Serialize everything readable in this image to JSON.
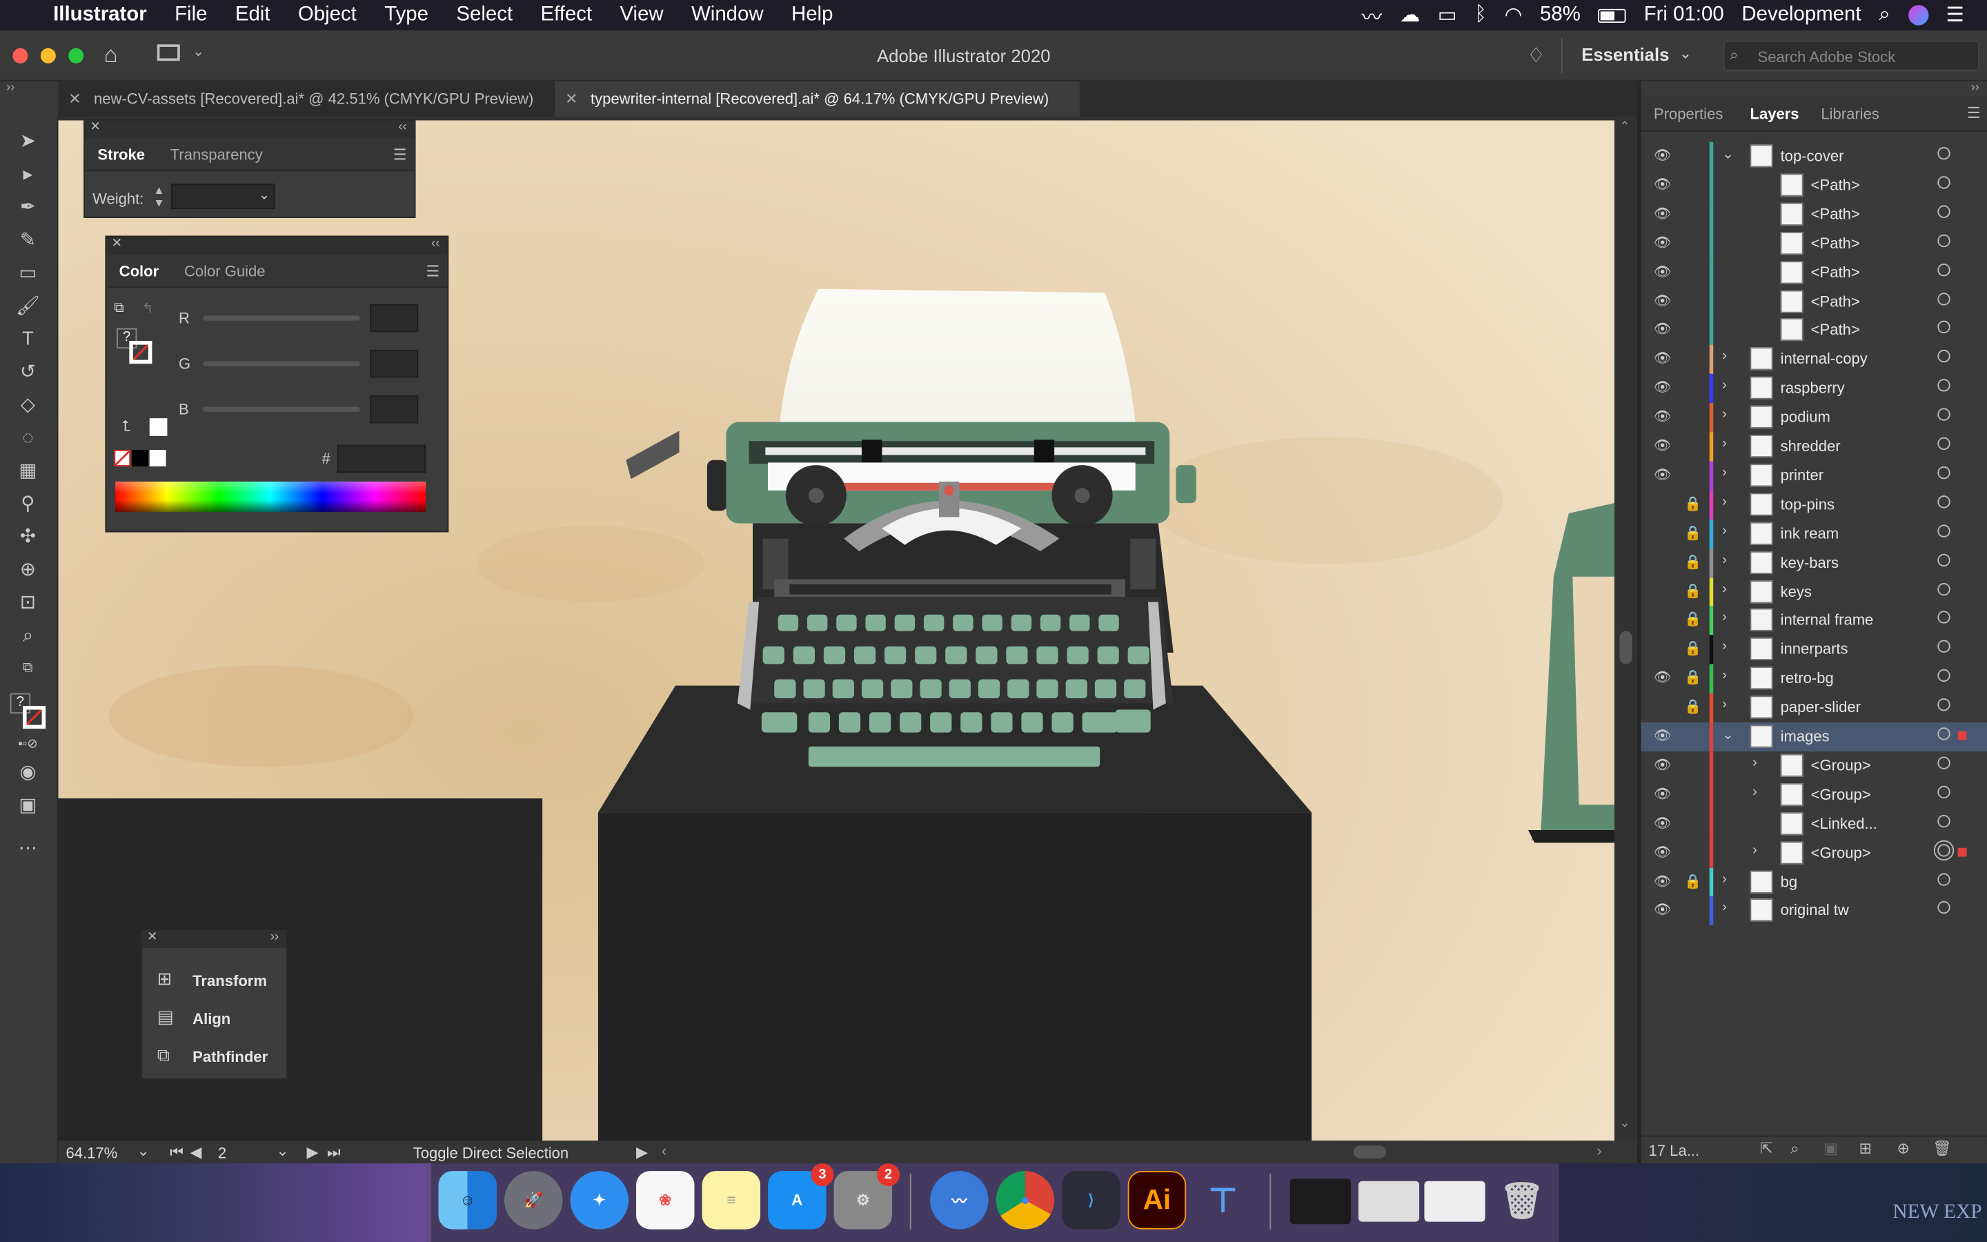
{
  "menubar": {
    "app_name": "Illustrator",
    "items": [
      "File",
      "Edit",
      "Object",
      "Type",
      "Select",
      "Effect",
      "View",
      "Window",
      "Help"
    ],
    "battery": "58%",
    "clock": "Fri 01:00",
    "profile": "Development"
  },
  "appbar": {
    "title": "Adobe Illustrator 2020",
    "workspace": "Essentials",
    "search_placeholder": "Search Adobe Stock"
  },
  "tabs": [
    {
      "label": "new-CV-assets [Recovered].ai* @ 42.51% (CMYK/GPU Preview)",
      "active": false
    },
    {
      "label": "typewriter-internal [Recovered].ai* @ 64.17% (CMYK/GPU Preview)",
      "active": true
    }
  ],
  "stroke_panel": {
    "tab_stroke": "Stroke",
    "tab_transparency": "Transparency",
    "weight_label": "Weight:"
  },
  "color_panel": {
    "tab_color": "Color",
    "tab_guide": "Color Guide",
    "r_label": "R",
    "g_label": "G",
    "b_label": "B",
    "hex_label": "#",
    "unknown_mark": "?"
  },
  "mini_panel": {
    "items": [
      "Transform",
      "Align",
      "Pathfinder"
    ]
  },
  "layers_panel": {
    "tabs": [
      "Properties",
      "Layers",
      "Libraries"
    ],
    "active_tab": "Layers",
    "footer_count": "17 La...",
    "rows": [
      {
        "name": "top-cover",
        "level": 0,
        "eye": true,
        "lock": false,
        "expanded": true,
        "color": "#3aa9a0"
      },
      {
        "name": "<Path>",
        "level": 1,
        "eye": true,
        "lock": false,
        "color": "#3aa9a0"
      },
      {
        "name": "<Path>",
        "level": 1,
        "eye": true,
        "lock": false,
        "color": "#3aa9a0"
      },
      {
        "name": "<Path>",
        "level": 1,
        "eye": true,
        "lock": false,
        "color": "#3aa9a0"
      },
      {
        "name": "<Path>",
        "level": 1,
        "eye": true,
        "lock": false,
        "color": "#3aa9a0"
      },
      {
        "name": "<Path>",
        "level": 1,
        "eye": true,
        "lock": false,
        "color": "#3aa9a0"
      },
      {
        "name": "<Path>",
        "level": 1,
        "eye": true,
        "lock": false,
        "color": "#3aa9a0"
      },
      {
        "name": "internal-copy",
        "level": 0,
        "eye": true,
        "lock": false,
        "collapsed": true,
        "color": "#e0a070"
      },
      {
        "name": "raspberry",
        "level": 0,
        "eye": true,
        "lock": false,
        "collapsed": true,
        "color": "#3a3aff"
      },
      {
        "name": "podium",
        "level": 0,
        "eye": true,
        "lock": false,
        "collapsed": true,
        "color": "#e06030"
      },
      {
        "name": "shredder",
        "level": 0,
        "eye": true,
        "lock": false,
        "collapsed": true,
        "color": "#f0a020"
      },
      {
        "name": "printer",
        "level": 0,
        "eye": true,
        "lock": false,
        "collapsed": true,
        "color": "#b040e0"
      },
      {
        "name": "top-pins",
        "level": 0,
        "eye": false,
        "lock": true,
        "collapsed": true,
        "color": "#e040c0"
      },
      {
        "name": "ink ream",
        "level": 0,
        "eye": false,
        "lock": true,
        "collapsed": true,
        "color": "#30b0e0"
      },
      {
        "name": "key-bars",
        "level": 0,
        "eye": false,
        "lock": true,
        "collapsed": true,
        "color": "#909090"
      },
      {
        "name": "keys",
        "level": 0,
        "eye": false,
        "lock": true,
        "collapsed": true,
        "color": "#e0e030"
      },
      {
        "name": "internal frame",
        "level": 0,
        "eye": false,
        "lock": true,
        "collapsed": true,
        "color": "#40d060"
      },
      {
        "name": "innerparts",
        "level": 0,
        "eye": false,
        "lock": true,
        "collapsed": true,
        "color": "#111111"
      },
      {
        "name": "retro-bg",
        "level": 0,
        "eye": true,
        "lock": true,
        "collapsed": true,
        "color": "#30c050"
      },
      {
        "name": "paper-slider",
        "level": 0,
        "eye": false,
        "lock": true,
        "collapsed": true,
        "color": "#e05030"
      },
      {
        "name": "images",
        "level": 0,
        "eye": true,
        "lock": false,
        "expanded": true,
        "selected": true,
        "color": "#e04040"
      },
      {
        "name": "<Group>",
        "level": 1,
        "eye": true,
        "lock": false,
        "collapsed": true,
        "color": "#e04040"
      },
      {
        "name": "<Group>",
        "level": 1,
        "eye": true,
        "lock": false,
        "collapsed": true,
        "color": "#e04040"
      },
      {
        "name": "<Linked...",
        "level": 1,
        "eye": true,
        "lock": false,
        "color": "#e04040"
      },
      {
        "name": "<Group>",
        "level": 1,
        "eye": true,
        "lock": false,
        "collapsed": true,
        "target": true,
        "color": "#e04040"
      },
      {
        "name": "bg",
        "level": 0,
        "eye": true,
        "lock": true,
        "collapsed": true,
        "color": "#40d0d0"
      },
      {
        "name": "original tw",
        "level": 0,
        "eye": true,
        "lock": false,
        "collapsed": true,
        "color": "#4060e0"
      }
    ]
  },
  "status": {
    "zoom": "64.17%",
    "artboard": "2",
    "tool_hint": "Toggle Direct Selection"
  },
  "dock": {
    "appstore_badge": "3",
    "settings_badge": "2",
    "ai_label": "Ai",
    "corner_text": "NEW EXP"
  }
}
